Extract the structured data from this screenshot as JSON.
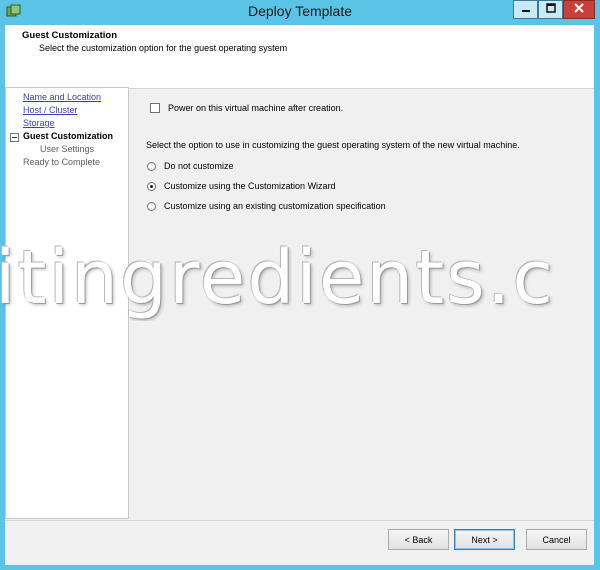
{
  "window": {
    "title": "Deploy Template",
    "icons": {
      "app": "vsphere-app-icon",
      "minimize": "minimize-icon",
      "maximize": "maximize-icon",
      "close": "close-icon"
    }
  },
  "header": {
    "title": "Guest Customization",
    "subtitle": "Select the customization option for the guest operating system"
  },
  "nav": {
    "items": [
      {
        "label": "Name and Location",
        "state": "link"
      },
      {
        "label": "Host / Cluster",
        "state": "link"
      },
      {
        "label": "Storage",
        "state": "link"
      },
      {
        "label": "Guest Customization",
        "state": "current"
      },
      {
        "label": "User Settings",
        "state": "pending"
      },
      {
        "label": "Ready to Complete",
        "state": "pending"
      }
    ]
  },
  "content": {
    "power_on_label": "Power on this virtual machine after creation.",
    "power_on_checked": false,
    "prompt": "Select the option to use in customizing the guest operating system of the new virtual machine.",
    "options": [
      {
        "label": "Do not customize",
        "selected": false
      },
      {
        "label": "Customize using the Customization Wizard",
        "selected": true
      },
      {
        "label": "Customize using an existing customization specification",
        "selected": false
      }
    ]
  },
  "watermark": "itingredients.c",
  "footer": {
    "back_label": "< Back",
    "next_label": "Next >",
    "cancel_label": "Cancel"
  },
  "colors": {
    "titlebar": "#5bc4e6",
    "close_button": "#c7413a",
    "link": "#3d3db8",
    "dialog_bg": "#f0f0f0"
  }
}
